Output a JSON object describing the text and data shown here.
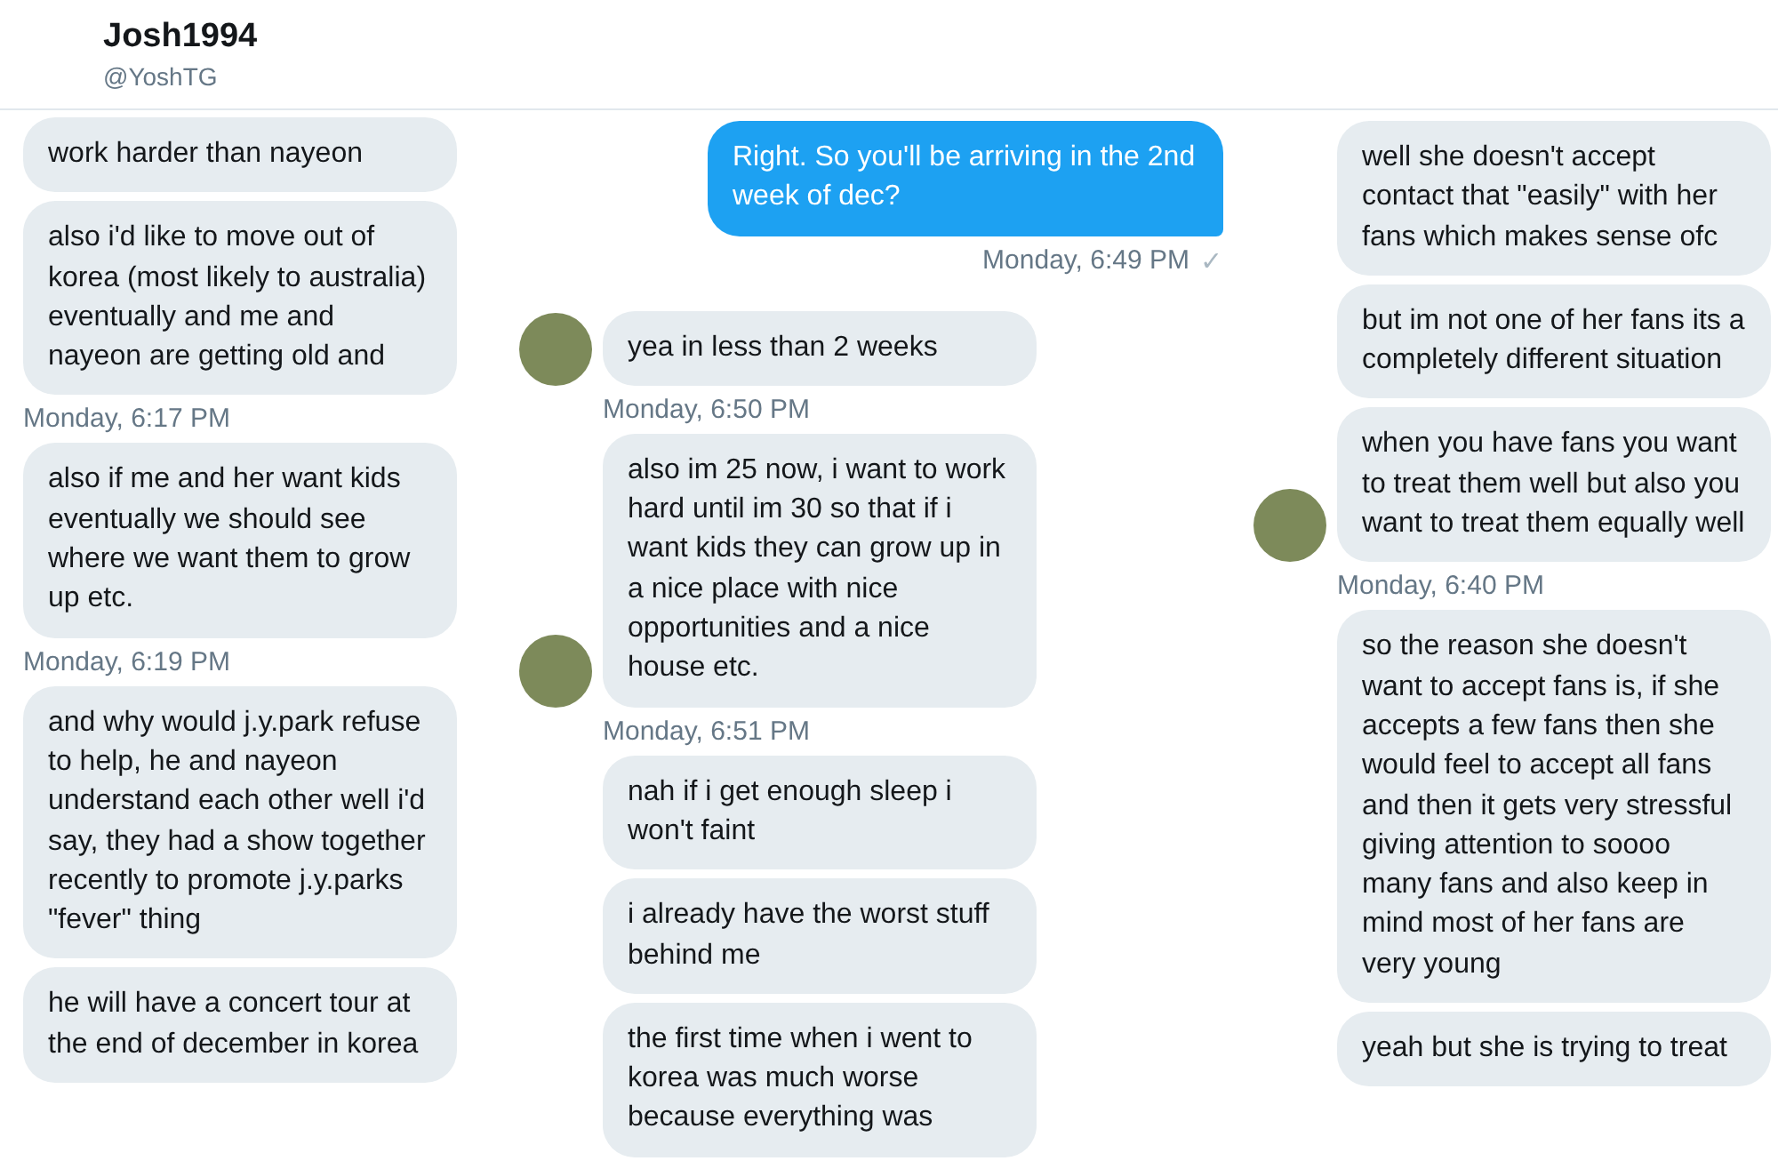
{
  "header": {
    "name": "Josh1994",
    "handle": "@YoshTG"
  },
  "columns": [
    {
      "items": [
        {
          "kind": "received",
          "text": "work harder than nayeon"
        },
        {
          "kind": "received",
          "text": "also i'd like to move out of korea (most likely to australia) eventually and me and nayeon are getting old and"
        },
        {
          "kind": "time",
          "text": "Monday, 6:17 PM"
        },
        {
          "kind": "received",
          "text": "also if me and her want kids eventually we should see where we want them to grow up etc."
        },
        {
          "kind": "time",
          "text": "Monday, 6:19 PM"
        },
        {
          "kind": "received",
          "text": "and why would j.y.park refuse to help, he and nayeon understand each other well i'd say, they had a show together recently to promote j.y.parks \"fever\" thing"
        },
        {
          "kind": "received",
          "text": "he will have a concert tour at the end of december in korea"
        }
      ]
    },
    {
      "items": [
        {
          "kind": "sent",
          "text": "Right. So you'll be arriving in the 2nd week of dec?"
        },
        {
          "kind": "time",
          "text": "Monday, 6:49 PM",
          "tick": "✓"
        },
        {
          "kind": "received",
          "text": "yea in less than 2 weeks",
          "avatar": true
        },
        {
          "kind": "time",
          "text": "Monday, 6:50 PM"
        },
        {
          "kind": "received",
          "text": "also im 25 now, i want to work hard until im 30 so that if i want kids they can grow up in a nice place with nice opportunities and a nice house etc.",
          "avatar": true
        },
        {
          "kind": "time",
          "text": "Monday, 6:51 PM"
        },
        {
          "kind": "received",
          "text": "nah if i get enough sleep i won't faint",
          "avatar": false
        },
        {
          "kind": "received",
          "text": "i already have the worst stuff behind me",
          "avatar": false
        },
        {
          "kind": "received",
          "text": "the first time when i went to korea was much worse because everything was",
          "avatar": false
        }
      ]
    },
    {
      "items": [
        {
          "kind": "received",
          "text": "well she doesn't accept contact that \"easily\" with her fans which makes sense ofc",
          "avatar": false
        },
        {
          "kind": "received",
          "text": "but im not one of her fans its a completely different situation",
          "avatar": false
        },
        {
          "kind": "received",
          "text": "when you have fans you want to treat them well but also you want to treat them equally well",
          "avatar": true
        },
        {
          "kind": "time",
          "text": "Monday, 6:40 PM"
        },
        {
          "kind": "received",
          "text": "so the reason she doesn't want to accept fans is, if she accepts a few fans then she would feel to accept all fans and then it gets very stressful giving attention to soooo many fans and also keep in mind most of her fans are very young",
          "avatar": false
        },
        {
          "kind": "received",
          "text": "yeah but she is trying to treat",
          "avatar": false
        }
      ]
    }
  ]
}
